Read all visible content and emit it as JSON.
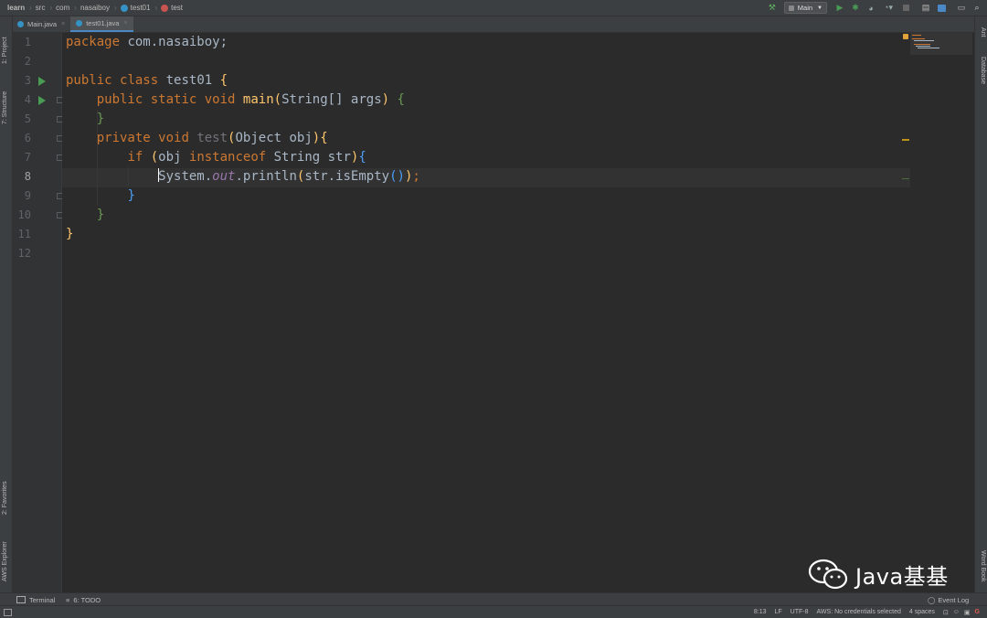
{
  "colors": {
    "keyword": "#cc7832",
    "function": "#ffc66d",
    "text": "#a9b7c6",
    "run_marker": "#499c54"
  },
  "breadcrumbs": [
    "learn",
    "src",
    "com",
    "nasaiboy",
    "test01",
    "test"
  ],
  "toolbar": {
    "run_config": "Main"
  },
  "tabs": [
    {
      "label": "Main.java",
      "active": false
    },
    {
      "label": "test01.java",
      "active": true
    }
  ],
  "left_tools": [
    "1: Project",
    "7: Structure",
    "2: Favorites",
    "AWS Explorer"
  ],
  "right_tools": [
    "Ant",
    "Database",
    "Word Book"
  ],
  "line_numbers": [
    "1",
    "2",
    "3",
    "4",
    "5",
    "6",
    "7",
    "8",
    "9",
    "10",
    "11",
    "12"
  ],
  "code": {
    "l1": {
      "kw": "package",
      "rest": " com.nasaiboy;"
    },
    "l3": {
      "kw1": "public",
      "kw2": "class",
      "name": " test01 ",
      "brace": "{"
    },
    "l4": {
      "kw1": "public",
      "kw2": "static",
      "kw3": "void",
      "fn": "main",
      "params": "String[] args",
      "brace": "{"
    },
    "l5": {
      "brace": "}"
    },
    "l6": {
      "kw1": "private",
      "kw2": "void",
      "fn": "test",
      "params": "Object obj",
      "brace": "{"
    },
    "l7": {
      "kw1": "if",
      "a": "obj ",
      "kw2": "instanceof",
      "b": " String str",
      "brace": "{"
    },
    "l8": {
      "cls": "System",
      "field": "out",
      "call": "println",
      "arg": "str.isEmpty",
      "semi": ";"
    },
    "l9": {
      "brace": "}"
    },
    "l10": {
      "brace": "}"
    },
    "l11": {
      "brace": "}"
    }
  },
  "bottom_tools": {
    "terminal": "Terminal",
    "todo": "6: TODO",
    "event_log": "Event Log"
  },
  "status": {
    "position": "8:13",
    "line_sep": "LF",
    "encoding": "UTF-8",
    "aws": "AWS: No credentials selected",
    "indent": "4 spaces"
  },
  "watermark": "Java基基"
}
